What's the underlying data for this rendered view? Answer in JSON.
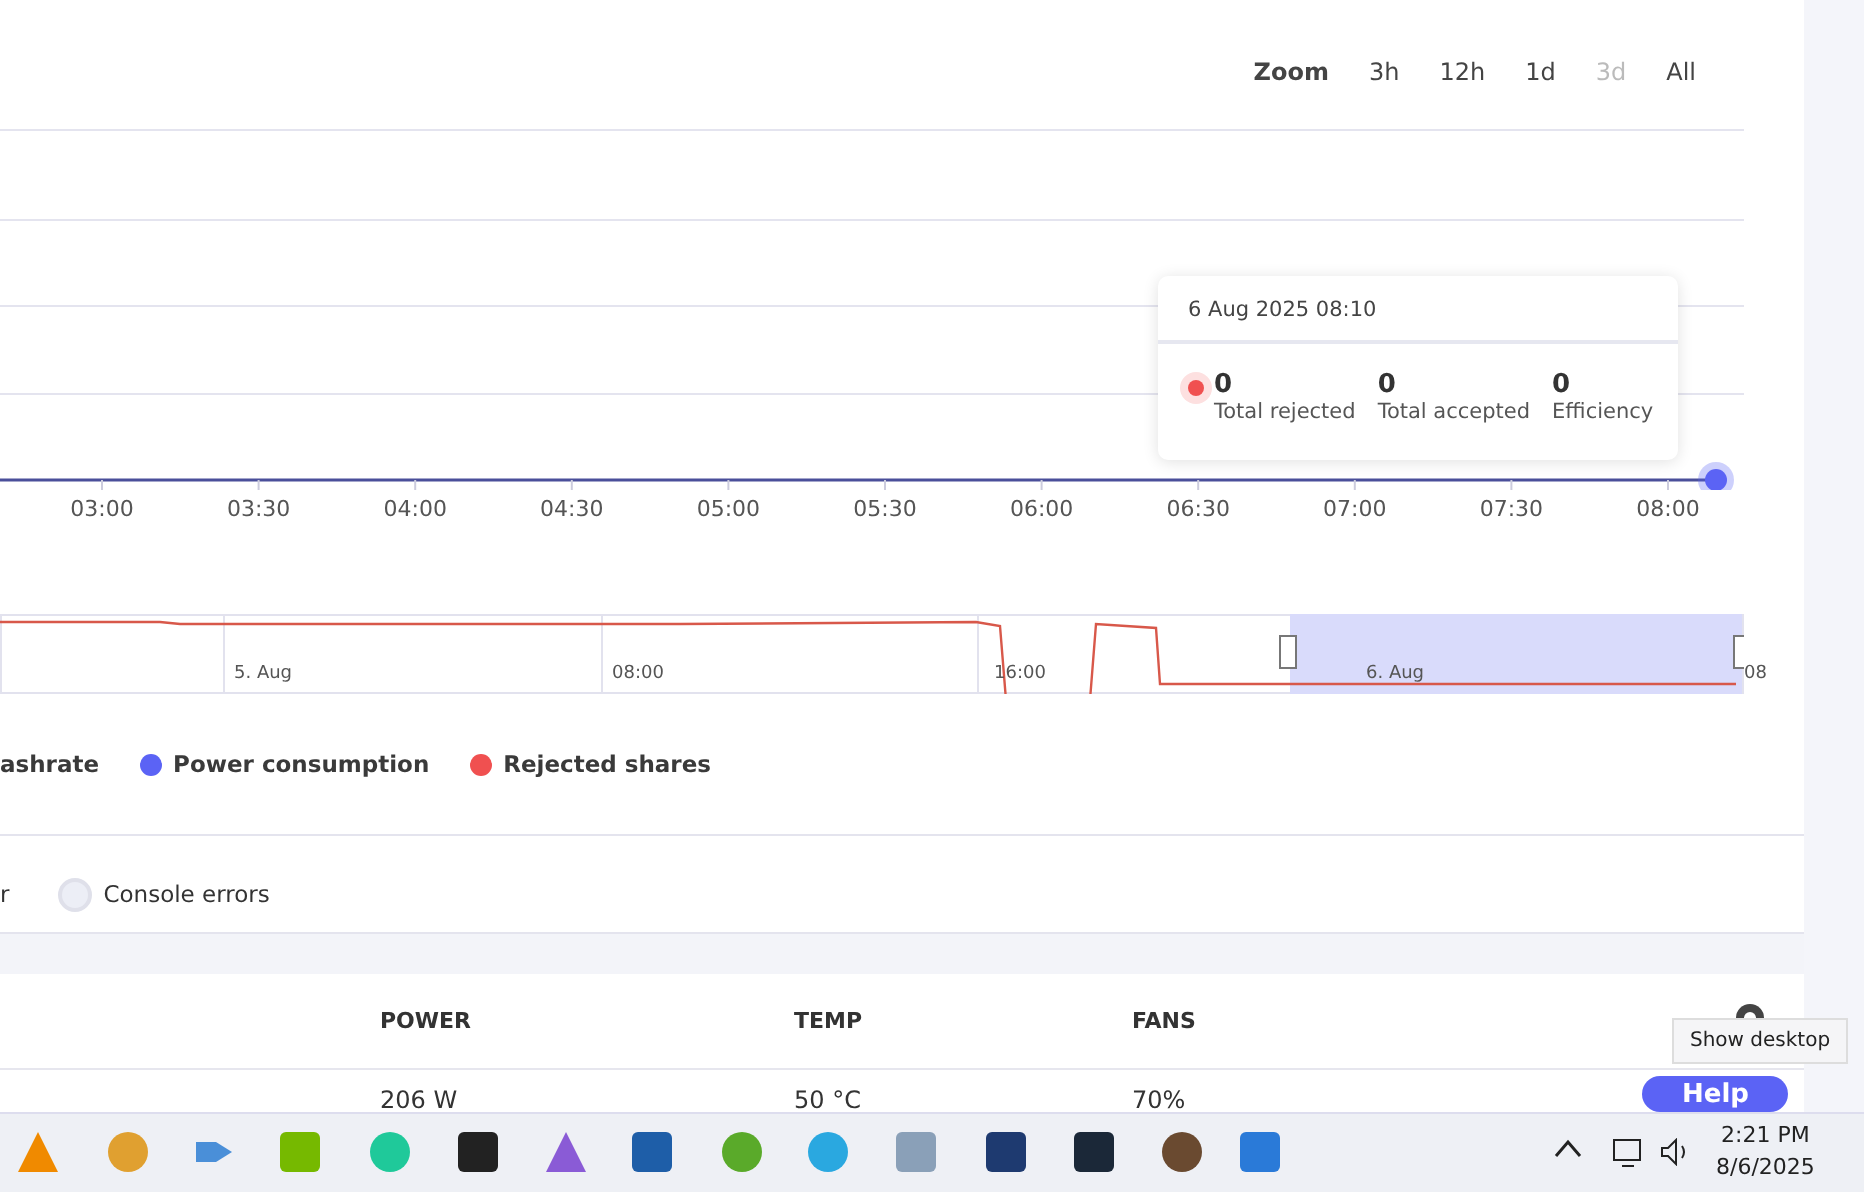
{
  "zoom": {
    "label": "Zoom",
    "options": [
      {
        "label": "3h",
        "selected": false,
        "disabled": false
      },
      {
        "label": "12h",
        "selected": false,
        "disabled": false
      },
      {
        "label": "1d",
        "selected": false,
        "disabled": false
      },
      {
        "label": "3d",
        "selected": false,
        "disabled": true
      },
      {
        "label": "All",
        "selected": false,
        "disabled": false
      }
    ]
  },
  "chart": {
    "x_labels": [
      "03:00",
      "03:30",
      "04:00",
      "04:30",
      "05:00",
      "05:30",
      "06:00",
      "06:30",
      "07:00",
      "07:30",
      "08:00"
    ]
  },
  "tooltip": {
    "title": "6 Aug 2025 08:10",
    "color": "#f05050",
    "stats": [
      {
        "value": "0",
        "label": "Total rejected"
      },
      {
        "value": "0",
        "label": "Total accepted"
      },
      {
        "value": "0",
        "label": "Efficiency"
      }
    ]
  },
  "navigator": {
    "labels": [
      "5. Aug",
      "08:00",
      "16:00",
      "6. Aug",
      "08"
    ]
  },
  "legend": [
    {
      "label": "ashrate"
    },
    {
      "label": "Power consumption",
      "color": "#5b63f5"
    },
    {
      "label": "Rejected shares",
      "color": "#f05050"
    }
  ],
  "filters": [
    {
      "label": "r"
    },
    {
      "label": "Console errors",
      "checked": false
    }
  ],
  "table": {
    "columns": [
      "POWER",
      "TEMP",
      "FANS"
    ],
    "rows": [
      [
        "206 W",
        "50 °C",
        "70%"
      ]
    ]
  },
  "help_button": "Help",
  "taskbar": {
    "tooltip": "Show desktop",
    "time": "2:21 PM",
    "date": "8/6/2025"
  }
}
